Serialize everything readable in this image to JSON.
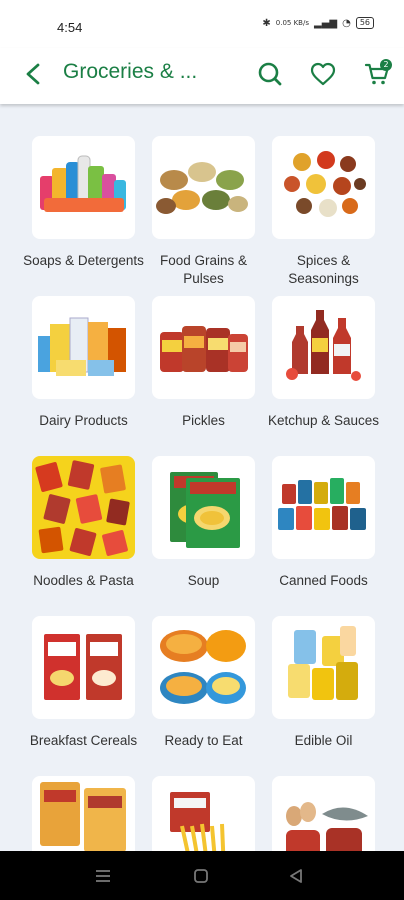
{
  "status": {
    "time": "4:54",
    "net": "0.05 KB/s",
    "battery": "56"
  },
  "header": {
    "title": "Groceries & ...",
    "cart_count": "2"
  },
  "categories": [
    {
      "label": "Soaps & Detergents"
    },
    {
      "label": "Food Grains & Pulses"
    },
    {
      "label": "Spices & Seasonings"
    },
    {
      "label": "Dairy Products"
    },
    {
      "label": "Pickles"
    },
    {
      "label": "Ketchup & Sauces"
    },
    {
      "label": "Noodles & Pasta"
    },
    {
      "label": "Soup"
    },
    {
      "label": "Canned Foods"
    },
    {
      "label": "Breakfast Cereals"
    },
    {
      "label": "Ready to Eat"
    },
    {
      "label": "Edible Oil"
    }
  ],
  "colors": {
    "brand": "#1b7f45",
    "background": "#edf1f7"
  }
}
